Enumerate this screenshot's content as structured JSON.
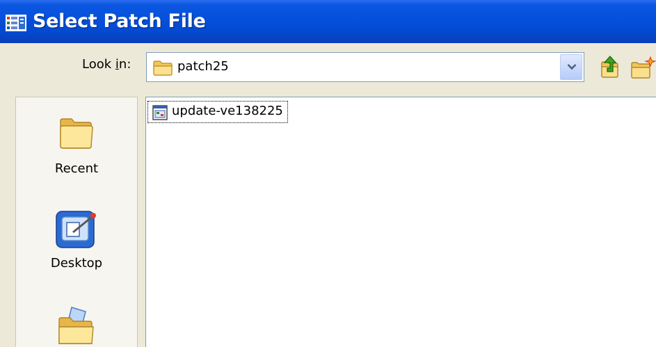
{
  "window": {
    "title": "Select Patch File",
    "icon": "app-icon"
  },
  "toolbar": {
    "look_in_prefix": "Look ",
    "look_in_accel": "i",
    "look_in_suffix": "n:",
    "look_in_value": "patch25",
    "buttons": [
      "up-one-level-icon",
      "new-folder-icon"
    ]
  },
  "places": {
    "items": [
      {
        "label": "Recent",
        "icon": "recent-folder-icon"
      },
      {
        "label": "Desktop",
        "icon": "desktop-icon"
      },
      {
        "label": "",
        "icon": "my-documents-icon"
      }
    ]
  },
  "files": {
    "items": [
      {
        "name": "update-ve138225",
        "icon": "patch-file-icon",
        "focused": true
      }
    ]
  },
  "colors": {
    "titlebar": "#0550dc",
    "window_bg": "#ece9d8",
    "field_border": "#7f9db9"
  }
}
